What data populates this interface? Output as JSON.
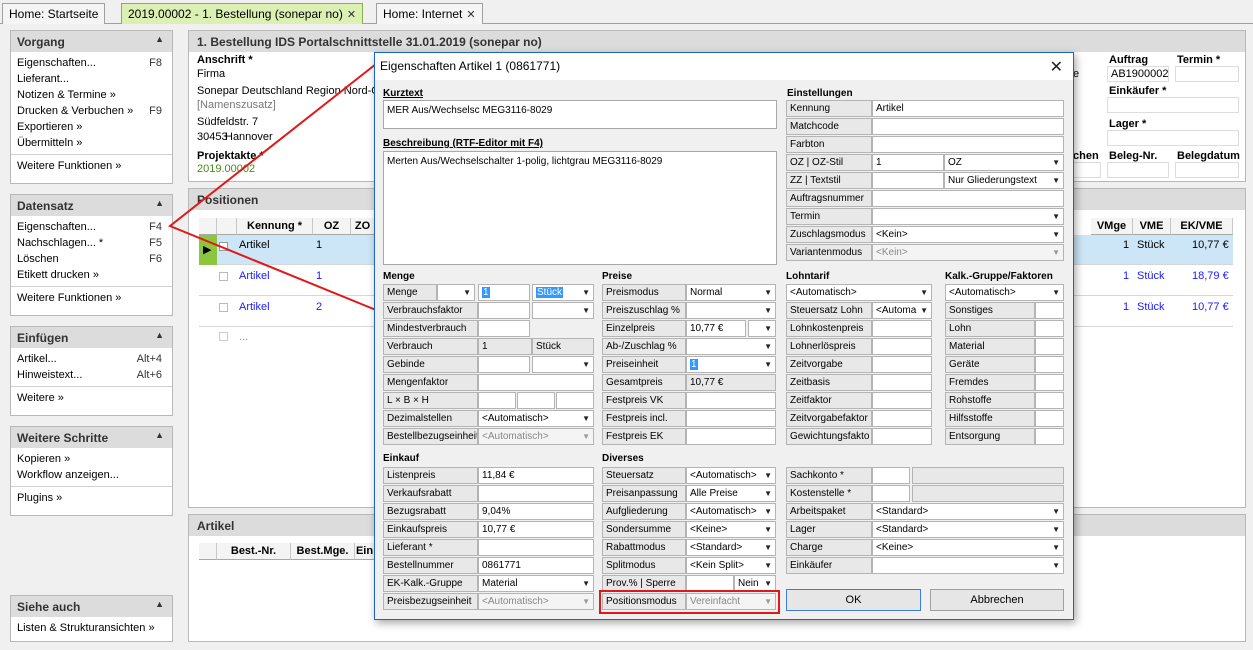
{
  "tabs": [
    {
      "label": "Home: Startseite"
    },
    {
      "label": "2019.00002 - 1. Bestellung (sonepar no)"
    },
    {
      "label": "Home: Internet"
    }
  ],
  "left": {
    "vorgang": {
      "title": "Vorgang",
      "items": [
        {
          "label": "Eigenschaften...",
          "key": "F8"
        },
        {
          "label": "Lieferant..."
        },
        {
          "label": "Notizen & Termine »"
        },
        {
          "label": "Drucken & Verbuchen »",
          "key": "F9"
        },
        {
          "label": "Exportieren »"
        },
        {
          "label": "Übermitteln »"
        }
      ],
      "more": "Weitere Funktionen »"
    },
    "datensatz": {
      "title": "Datensatz",
      "items": [
        {
          "label": "Eigenschaften...",
          "key": "F4"
        },
        {
          "label": "Nachschlagen... *",
          "key": "F5"
        },
        {
          "label": "Löschen",
          "key": "F6"
        },
        {
          "label": "Etikett drucken »"
        }
      ],
      "more": "Weitere Funktionen »"
    },
    "einfuegen": {
      "title": "Einfügen",
      "items": [
        {
          "label": "Artikel...",
          "key": "Alt+4"
        },
        {
          "label": "Hinweistext...",
          "key": "Alt+6"
        }
      ],
      "more": "Weitere »"
    },
    "schritte": {
      "title": "Weitere Schritte",
      "items": [
        {
          "label": "Kopieren »"
        },
        {
          "label": "Workflow anzeigen..."
        }
      ],
      "more": "Plugins »"
    },
    "siehe": {
      "title": "Siehe auch",
      "items": [
        {
          "label": "Listen & Strukturansichten »"
        }
      ]
    }
  },
  "main": {
    "title": "1. Bestellung IDS Portalschnittstelle 31.01.2019 (sonepar no)",
    "anschrift": "Anschrift *",
    "firma": "Firma",
    "company": "Sonepar Deutschland Region Nord-O",
    "namenszusatz": "[Namenszusatz]",
    "street": "Südfeldstr. 7",
    "zip": "30453",
    "city": "Hannover",
    "projektakte": "Projektakte *",
    "projekt": "2019.00002",
    "auftrag_label": "Auftrag",
    "auftrag": "AB1900002",
    "termin_label": "Termin *",
    "einkaeufer_label": "Einkäufer *",
    "lager_label": "Lager *",
    "chen": "chen",
    "beleg_nr": "Beleg-Nr.",
    "belegdatum": "Belegdatum",
    "e_frag": "e"
  },
  "positions": {
    "title": "Positionen",
    "cols": {
      "kennung": "Kennung *",
      "oz": "OZ",
      "zo": "ZO",
      "vmge": "VMge",
      "vme": "VME",
      "ek": "EK/VME"
    },
    "rows": [
      {
        "kennung": "Artikel",
        "oz": "1",
        "vmge": "1",
        "vme": "Stück",
        "ek": "10,77 €"
      },
      {
        "kennung": "Artikel",
        "oz": "1",
        "vmge": "1",
        "vme": "Stück",
        "ek": "18,79 €"
      },
      {
        "kennung": "Artikel",
        "oz": "2",
        "vmge": "1",
        "vme": "Stück",
        "ek": "10,77 €"
      }
    ],
    "new_row": "..."
  },
  "artikel": {
    "title": "Artikel",
    "cols": {
      "best_nr": "Best.-Nr.",
      "best_mge": "Best.Mge.",
      "ein": "Ein"
    }
  },
  "dialog": {
    "title": "Eigenschaften Artikel 1 (0861771)",
    "kurztext_label": "Kurztext",
    "kurztext": "MER Aus/Wechselsc MEG3116-8029",
    "beschreibung_label": "Beschreibung (RTF-Editor mit F4)",
    "beschreibung": "Merten Aus/Wechselschalter 1-polig, lichtgrau MEG3116-8029",
    "einstellungen": {
      "title": "Einstellungen",
      "kennung": "Kennung",
      "kennung_v": "Artikel",
      "matchcode": "Matchcode",
      "farbton": "Farbton",
      "oz": "OZ | OZ-Stil",
      "oz_v": "1",
      "oz_stil": "OZ",
      "zz": "ZZ | Textstil",
      "textstil": "Nur Gliederungstext",
      "auftragsnummer": "Auftragsnummer",
      "termin": "Termin",
      "zuschlagsmodus": "Zuschlagsmodus",
      "zuschlagsmodus_v": "<Kein>",
      "variantenmodus": "Variantenmodus",
      "variantenmodus_v": "<Kein>"
    },
    "menge": {
      "title": "Menge",
      "menge": "Menge",
      "menge_v": "1",
      "menge_unit": "Stück",
      "verbrauchsfaktor": "Verbrauchsfaktor",
      "mindestverbrauch": "Mindestverbrauch",
      "verbrauch": "Verbrauch",
      "verbrauch_v": "1",
      "verbrauch_unit": "Stück",
      "gebinde": "Gebinde",
      "mengenfaktor": "Mengenfaktor",
      "lbh": "L × B × H",
      "dezimalstellen": "Dezimalstellen",
      "dezimalstellen_v": "<Automatisch>",
      "bestellbezug": "Bestellbezugseinheit",
      "bestellbezug_v": "<Automatisch>"
    },
    "preise": {
      "title": "Preise",
      "preismodus": "Preismodus",
      "preismodus_v": "Normal",
      "preiszuschlag": "Preiszuschlag %",
      "einzelpreis": "Einzelpreis",
      "einzelpreis_v": "10,77 €",
      "abzuschlag": "Ab-/Zuschlag %",
      "preiseinheit": "Preiseinheit",
      "preiseinheit_v": "1",
      "gesamtpreis": "Gesamtpreis",
      "gesamtpreis_v": "10,77 €",
      "festpreis_vk": "Festpreis VK",
      "festpreis_incl": "Festpreis incl.",
      "festpreis_ek": "Festpreis EK"
    },
    "lohntarif": {
      "title": "Lohntarif",
      "tarif_v": "<Automatisch>",
      "steuersatz_lohn": "Steuersatz Lohn",
      "steuersatz_lohn_v": "<Automa",
      "lohnkostenpreis": "Lohnkostenpreis",
      "lohnerloespreis": "Lohnerlöspreis",
      "zeitvorgabe": "Zeitvorgabe",
      "zeitbasis": "Zeitbasis",
      "zeitfaktor": "Zeitfaktor",
      "zeitvorgabefaktor": "Zeitvorgabefaktor",
      "gewichtungsfaktor": "Gewichtungsfakto"
    },
    "kalk": {
      "title": "Kalk.-Gruppe/Faktoren",
      "gruppe_v": "<Automatisch>",
      "items": [
        "Sonstiges",
        "Lohn",
        "Material",
        "Geräte",
        "Fremdes",
        "Rohstoffe",
        "Hilfsstoffe",
        "Entsorgung"
      ]
    },
    "einkauf": {
      "title": "Einkauf",
      "listenpreis": "Listenpreis",
      "listenpreis_v": "11,84 €",
      "verkaufsrabatt": "Verkaufsrabatt",
      "bezugsrabatt": "Bezugsrabatt",
      "bezugsrabatt_v": "9,04%",
      "einkaufspreis": "Einkaufspreis",
      "einkaufspreis_v": "10,77 €",
      "lieferant": "Lieferant *",
      "bestellnummer": "Bestellnummer",
      "bestellnummer_v": "0861771",
      "ekkalk": "EK-Kalk.-Gruppe",
      "ekkalk_v": "Material",
      "preisbezug": "Preisbezugseinheit",
      "preisbezug_v": "<Automatisch>"
    },
    "diverses": {
      "title": "Diverses",
      "steuersatz": "Steuersatz",
      "steuersatz_v": "<Automatisch>",
      "preisanpassung": "Preisanpassung",
      "preisanpassung_v": "Alle Preise",
      "aufgliederung": "Aufgliederung",
      "aufgliederung_v": "<Automatisch>",
      "sondersumme": "Sondersumme",
      "sondersumme_v": "<Keine>",
      "rabattmodus": "Rabattmodus",
      "rabattmodus_v": "<Standard>",
      "splitmodus": "Splitmodus",
      "splitmodus_v": "<Kein Split>",
      "prov": "Prov.% | Sperre",
      "sperre_v": "Nein",
      "positionsmodus": "Positionsmodus",
      "positionsmodus_v": "Vereinfacht"
    },
    "right": {
      "sachkonto": "Sachkonto *",
      "kostenstelle": "Kostenstelle *",
      "arbeitspaket": "Arbeitspaket",
      "arbeitspaket_v": "<Standard>",
      "lager": "Lager",
      "lager_v": "<Standard>",
      "charge": "Charge",
      "charge_v": "<Keine>",
      "einkaeufer": "Einkäufer"
    },
    "ok": "OK",
    "cancel": "Abbrechen"
  },
  "colors": {
    "accent_green": "#dcf0b4",
    "selection": "#cde6f7",
    "highlight_red": "#e01818",
    "link_blue": "#1a1aff"
  }
}
